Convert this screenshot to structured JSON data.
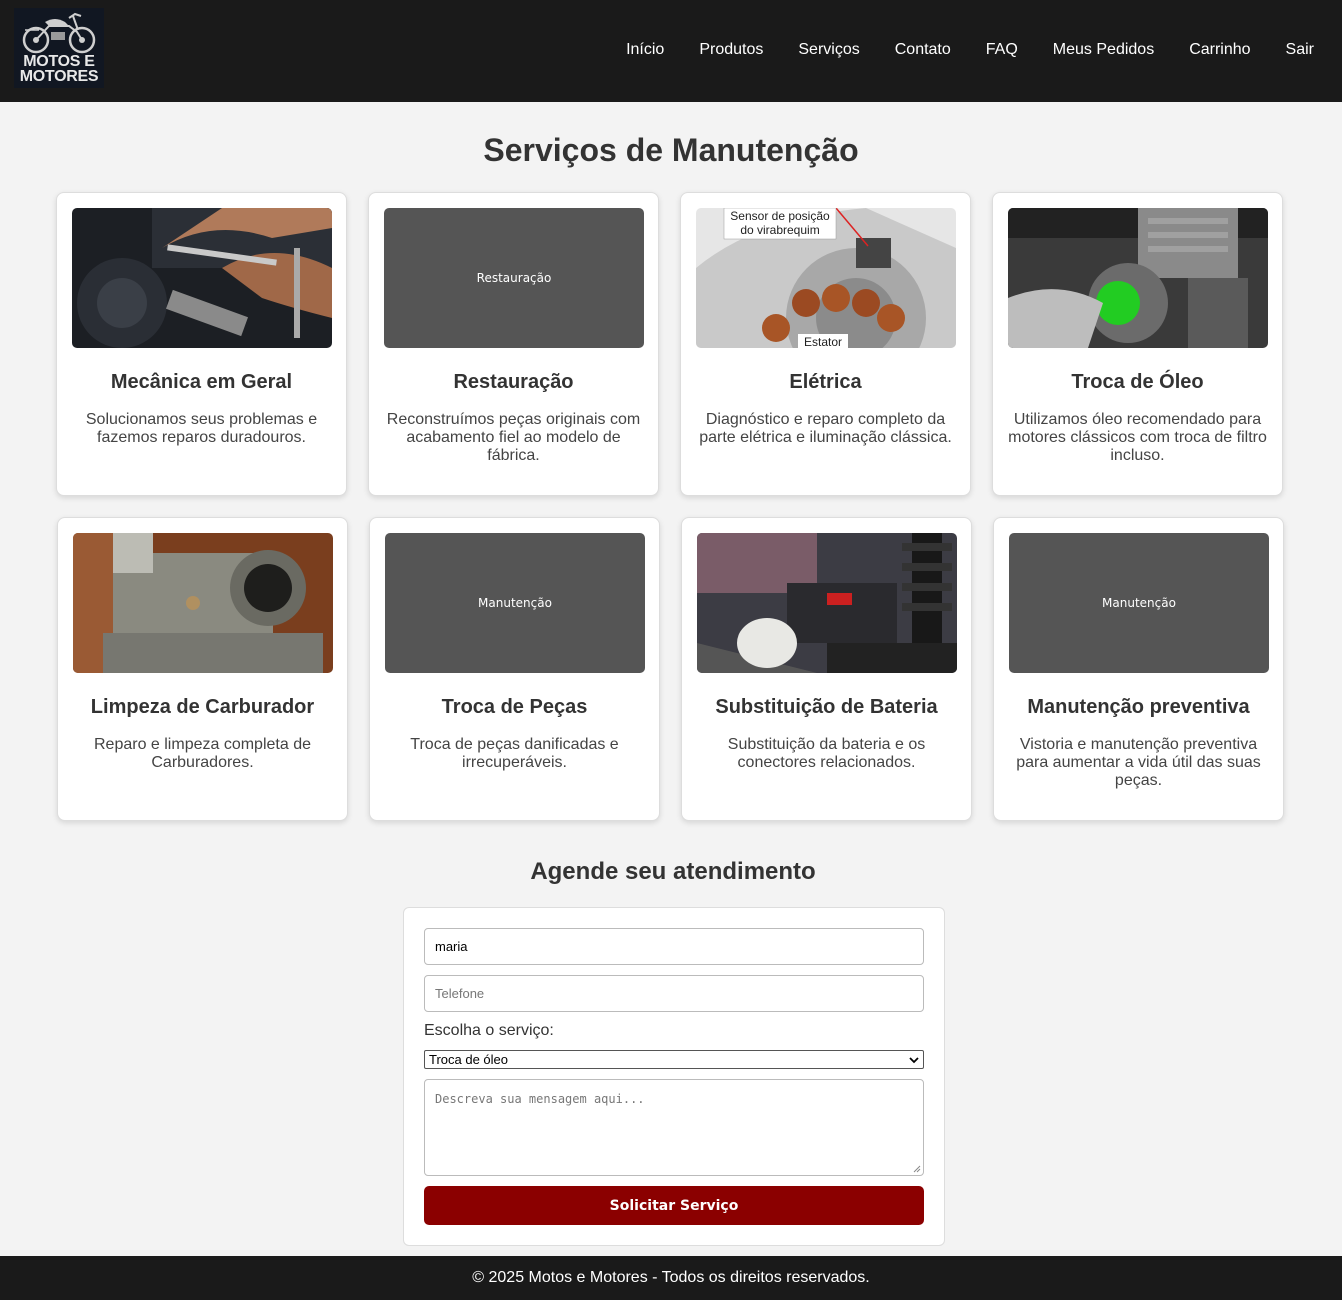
{
  "header": {
    "logo_text_line1": "MOTOS E",
    "logo_text_line2": "MOTORES",
    "nav": [
      "Início",
      "Produtos",
      "Serviços",
      "Contato",
      "FAQ",
      "Meus Pedidos",
      "Carrinho",
      "Sair"
    ]
  },
  "main": {
    "title": "Serviços de Manutenção",
    "services": [
      {
        "title": "Mecânica em Geral",
        "description": "Solucionamos seus problemas e fazemos reparos duradouros.",
        "image": "mechanic-photo"
      },
      {
        "title": "Restauração",
        "description": "Reconstruímos peças originais com acabamento fiel ao modelo de fábrica.",
        "image_placeholder": "Restauração"
      },
      {
        "title": "Elétrica",
        "description": "Diagnóstico e reparo completo da parte elétrica e iluminação clássica.",
        "image": "stator-photo",
        "image_labels": [
          "Sensor de posição",
          "do virabrequim",
          "Estator"
        ]
      },
      {
        "title": "Troca de Óleo",
        "description": "Utilizamos óleo recomendado para motores clássicos com troca de filtro incluso.",
        "image": "oil-change-photo"
      },
      {
        "title": "Limpeza de Carburador",
        "description": "Reparo e limpeza completa de Carburadores.",
        "image": "carburetor-photo"
      },
      {
        "title": "Troca de Peças",
        "description": "Troca de peças danificadas e irrecuperáveis.",
        "image_placeholder": "Manutenção"
      },
      {
        "title": "Substituição de Bateria",
        "description": "Substituição da bateria e os conectores relacionados.",
        "image": "battery-photo"
      },
      {
        "title": "Manutenção preventiva",
        "description": "Vistoria e manutenção preventiva para aumentar a vida útil das suas peças.",
        "image_placeholder": "Manutenção"
      }
    ]
  },
  "form": {
    "title": "Agende seu atendimento",
    "name_value": "maria",
    "phone_placeholder": "Telefone",
    "service_label": "Escolha o serviço:",
    "service_selected": "Troca de óleo",
    "message_placeholder": "Descreva sua mensagem aqui...",
    "submit_label": "Solicitar Serviço"
  },
  "footer": {
    "text": "© 2025 Motos e Motores - Todos os direitos reservados."
  },
  "colors": {
    "header_bg": "#1a1a1a",
    "page_bg": "#f3f3f3",
    "button_bg": "#8b0000",
    "placeholder_bg": "#555555"
  }
}
